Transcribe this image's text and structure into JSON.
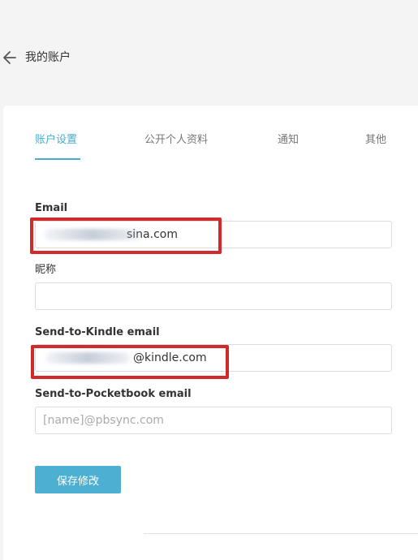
{
  "header": {
    "title": "我的账户",
    "back_icon": "arrow-left-icon"
  },
  "tabs": [
    {
      "label": "账户设置",
      "active": true
    },
    {
      "label": "公开个人资料",
      "active": false
    },
    {
      "label": "通知",
      "active": false
    },
    {
      "label": "其他",
      "active": false
    }
  ],
  "form": {
    "email": {
      "label": "Email",
      "value": "sina.com",
      "placeholder": ""
    },
    "nickname": {
      "label": "昵称",
      "value": "",
      "placeholder": ""
    },
    "kindle": {
      "label": "Send-to-Kindle email",
      "value": "@kindle.com",
      "placeholder": ""
    },
    "pocketbook": {
      "label": "Send-to-Pocketbook email",
      "value": "",
      "placeholder": "[name]@pbsync.com"
    }
  },
  "save_label": "保存修改",
  "colors": {
    "accent": "#4aacd0",
    "button": "#4db0d2",
    "highlight": "#d12a2a"
  }
}
